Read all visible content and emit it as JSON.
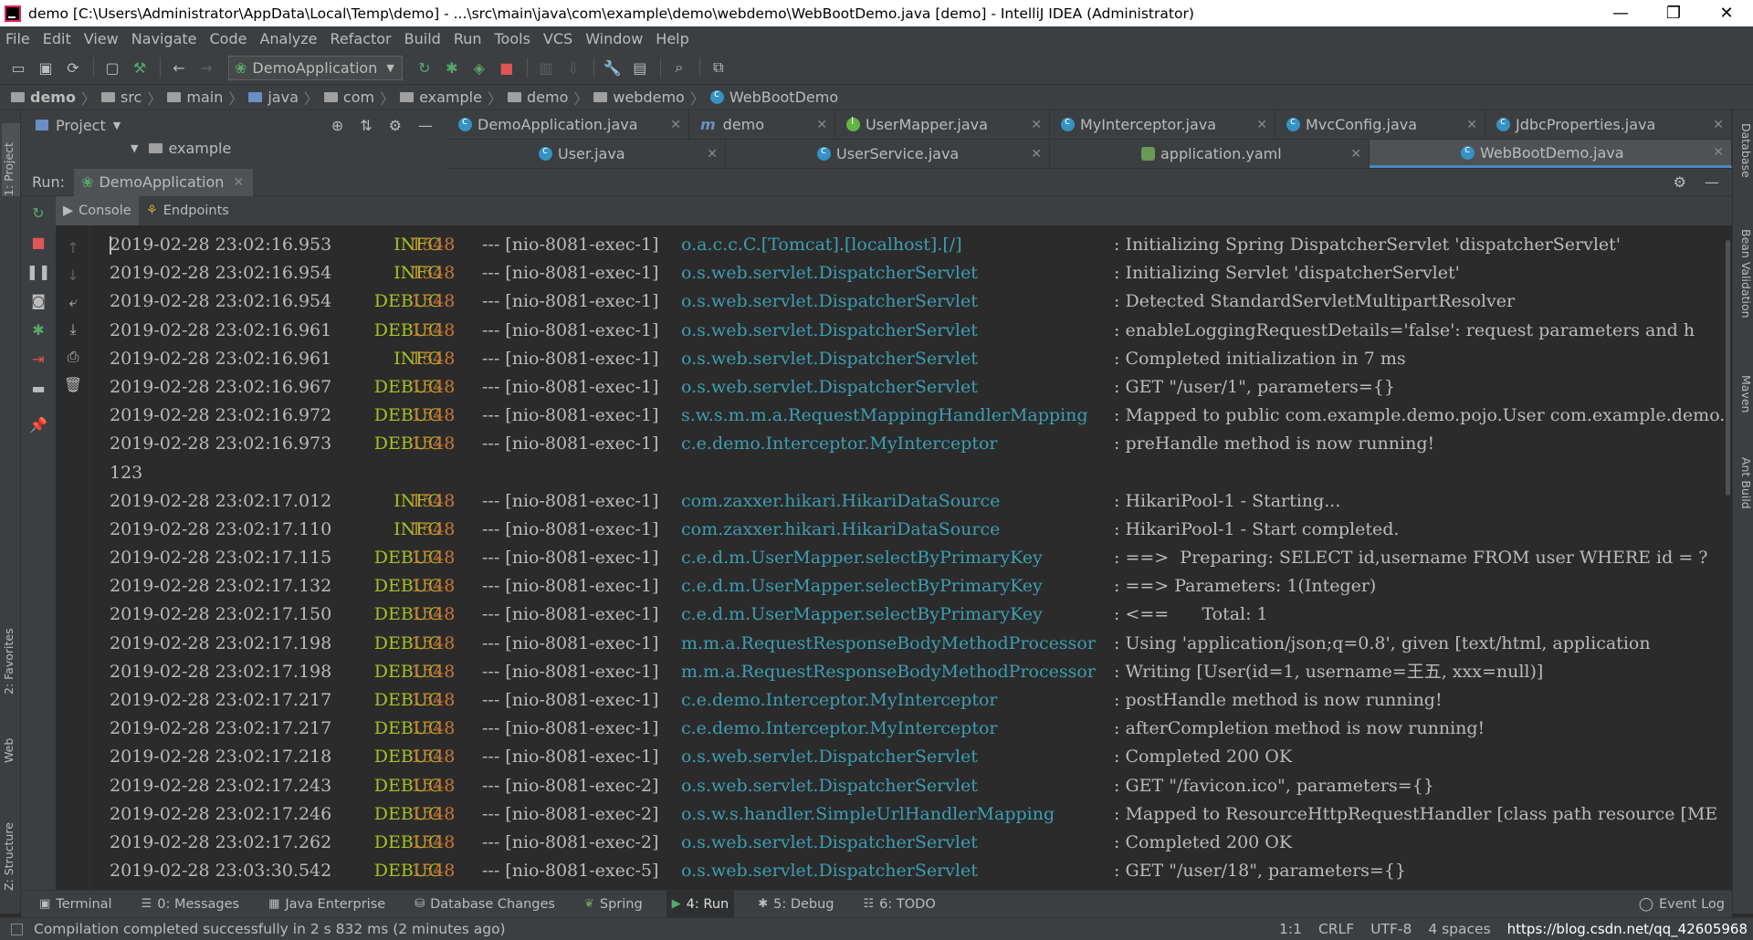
{
  "titlebar": {
    "title": "demo [C:\\Users\\Administrator\\AppData\\Local\\Temp\\demo] - ...\\src\\main\\java\\com\\example\\demo\\webdemo\\WebBootDemo.java [demo] - IntelliJ IDEA (Administrator)",
    "minimize": "—",
    "maximize": "❐",
    "close": "✕"
  },
  "menu": [
    "File",
    "Edit",
    "View",
    "Navigate",
    "Code",
    "Analyze",
    "Refactor",
    "Build",
    "Run",
    "Tools",
    "VCS",
    "Window",
    "Help"
  ],
  "toolbar": {
    "run_config": "DemoApplication"
  },
  "breadcrumb": [
    "demo",
    "src",
    "main",
    "java",
    "com",
    "example",
    "demo",
    "webdemo",
    "WebBootDemo"
  ],
  "project_panel": {
    "title": "Project",
    "tree_item": "example"
  },
  "tabs_row1": [
    {
      "label": "DemoApplication.java",
      "icon": "class-icon"
    },
    {
      "label": "demo",
      "icon": "module-icon"
    },
    {
      "label": "UserMapper.java",
      "icon": "interface-icon"
    },
    {
      "label": "MyInterceptor.java",
      "icon": "class-icon"
    },
    {
      "label": "MvcConfig.java",
      "icon": "class-icon"
    },
    {
      "label": "JdbcProperties.java",
      "icon": "class-icon"
    }
  ],
  "tabs_row2": [
    {
      "label": "User.java",
      "icon": "class-icon"
    },
    {
      "label": "UserService.java",
      "icon": "class-icon"
    },
    {
      "label": "application.yaml",
      "icon": "yaml-icon"
    },
    {
      "label": "WebBootDemo.java",
      "icon": "class-icon",
      "active": true
    }
  ],
  "run_panel": {
    "label": "Run:",
    "tab": "DemoApplication",
    "console_tab": "Console",
    "endpoints_tab": "Endpoints"
  },
  "console": {
    "lines": [
      {
        "ts": "2019-02-28 23:02:16.953",
        "level": "INFO",
        "pid": "1548",
        "thread": "--- [nio-8081-exec-1]",
        "logger": "o.a.c.c.C.[Tomcat].[localhost].[/]",
        "msg": ": Initializing Spring DispatcherServlet 'dispatcherServlet'"
      },
      {
        "ts": "2019-02-28 23:02:16.954",
        "level": "INFO",
        "pid": "1548",
        "thread": "--- [nio-8081-exec-1]",
        "logger": "o.s.web.servlet.DispatcherServlet",
        "msg": ": Initializing Servlet 'dispatcherServlet'"
      },
      {
        "ts": "2019-02-28 23:02:16.954",
        "level": "DEBUG",
        "pid": "1548",
        "thread": "--- [nio-8081-exec-1]",
        "logger": "o.s.web.servlet.DispatcherServlet",
        "msg": ": Detected StandardServletMultipartResolver"
      },
      {
        "ts": "2019-02-28 23:02:16.961",
        "level": "DEBUG",
        "pid": "1548",
        "thread": "--- [nio-8081-exec-1]",
        "logger": "o.s.web.servlet.DispatcherServlet",
        "msg": ": enableLoggingRequestDetails='false': request parameters and h"
      },
      {
        "ts": "2019-02-28 23:02:16.961",
        "level": "INFO",
        "pid": "1548",
        "thread": "--- [nio-8081-exec-1]",
        "logger": "o.s.web.servlet.DispatcherServlet",
        "msg": ": Completed initialization in 7 ms"
      },
      {
        "ts": "2019-02-28 23:02:16.967",
        "level": "DEBUG",
        "pid": "1548",
        "thread": "--- [nio-8081-exec-1]",
        "logger": "o.s.web.servlet.DispatcherServlet",
        "msg": ": GET \"/user/1\", parameters={}"
      },
      {
        "ts": "2019-02-28 23:02:16.972",
        "level": "DEBUG",
        "pid": "1548",
        "thread": "--- [nio-8081-exec-1]",
        "logger": "s.w.s.m.m.a.RequestMappingHandlerMapping",
        "msg": ": Mapped to public com.example.demo.pojo.User com.example.demo."
      },
      {
        "ts": "2019-02-28 23:02:16.973",
        "level": "DEBUG",
        "pid": "1548",
        "thread": "--- [nio-8081-exec-1]",
        "logger": "c.e.demo.Interceptor.MyInterceptor",
        "msg": ": preHandle method is now running!"
      },
      {
        "plain": "123"
      },
      {
        "ts": "2019-02-28 23:02:17.012",
        "level": "INFO",
        "pid": "1548",
        "thread": "--- [nio-8081-exec-1]",
        "logger": "com.zaxxer.hikari.HikariDataSource",
        "msg": ": HikariPool-1 - Starting..."
      },
      {
        "ts": "2019-02-28 23:02:17.110",
        "level": "INFO",
        "pid": "1548",
        "thread": "--- [nio-8081-exec-1]",
        "logger": "com.zaxxer.hikari.HikariDataSource",
        "msg": ": HikariPool-1 - Start completed."
      },
      {
        "ts": "2019-02-28 23:02:17.115",
        "level": "DEBUG",
        "pid": "1548",
        "thread": "--- [nio-8081-exec-1]",
        "logger": "c.e.d.m.UserMapper.selectByPrimaryKey",
        "msg": ": ==>  Preparing: SELECT id,username FROM user WHERE id = ?"
      },
      {
        "ts": "2019-02-28 23:02:17.132",
        "level": "DEBUG",
        "pid": "1548",
        "thread": "--- [nio-8081-exec-1]",
        "logger": "c.e.d.m.UserMapper.selectByPrimaryKey",
        "msg": ": ==> Parameters: 1(Integer)"
      },
      {
        "ts": "2019-02-28 23:02:17.150",
        "level": "DEBUG",
        "pid": "1548",
        "thread": "--- [nio-8081-exec-1]",
        "logger": "c.e.d.m.UserMapper.selectByPrimaryKey",
        "msg": ": <==      Total: 1"
      },
      {
        "ts": "2019-02-28 23:02:17.198",
        "level": "DEBUG",
        "pid": "1548",
        "thread": "--- [nio-8081-exec-1]",
        "logger": "m.m.a.RequestResponseBodyMethodProcessor",
        "msg": ": Using 'application/json;q=0.8', given [text/html, application"
      },
      {
        "ts": "2019-02-28 23:02:17.198",
        "level": "DEBUG",
        "pid": "1548",
        "thread": "--- [nio-8081-exec-1]",
        "logger": "m.m.a.RequestResponseBodyMethodProcessor",
        "msg": ": Writing [User(id=1, username=王五, xxx=null)]"
      },
      {
        "ts": "2019-02-28 23:02:17.217",
        "level": "DEBUG",
        "pid": "1548",
        "thread": "--- [nio-8081-exec-1]",
        "logger": "c.e.demo.Interceptor.MyInterceptor",
        "msg": ": postHandle method is now running!"
      },
      {
        "ts": "2019-02-28 23:02:17.217",
        "level": "DEBUG",
        "pid": "1548",
        "thread": "--- [nio-8081-exec-1]",
        "logger": "c.e.demo.Interceptor.MyInterceptor",
        "msg": ": afterCompletion method is now running!"
      },
      {
        "ts": "2019-02-28 23:02:17.218",
        "level": "DEBUG",
        "pid": "1548",
        "thread": "--- [nio-8081-exec-1]",
        "logger": "o.s.web.servlet.DispatcherServlet",
        "msg": ": Completed 200 OK"
      },
      {
        "ts": "2019-02-28 23:02:17.243",
        "level": "DEBUG",
        "pid": "1548",
        "thread": "--- [nio-8081-exec-2]",
        "logger": "o.s.web.servlet.DispatcherServlet",
        "msg": ": GET \"/favicon.ico\", parameters={}"
      },
      {
        "ts": "2019-02-28 23:02:17.246",
        "level": "DEBUG",
        "pid": "1548",
        "thread": "--- [nio-8081-exec-2]",
        "logger": "o.s.w.s.handler.SimpleUrlHandlerMapping",
        "msg": ": Mapped to ResourceHttpRequestHandler [class path resource [ME"
      },
      {
        "ts": "2019-02-28 23:02:17.262",
        "level": "DEBUG",
        "pid": "1548",
        "thread": "--- [nio-8081-exec-2]",
        "logger": "o.s.web.servlet.DispatcherServlet",
        "msg": ": Completed 200 OK"
      },
      {
        "ts": "2019-02-28 23:03:30.542",
        "level": "DEBUG",
        "pid": "1548",
        "thread": "--- [nio-8081-exec-5]",
        "logger": "o.s.web.servlet.DispatcherServlet",
        "msg": ": GET \"/user/18\", parameters={}"
      }
    ]
  },
  "left_strip": {
    "project": "1: Project",
    "favorites": "2: Favorites",
    "web": "Web",
    "structure": "Z: Structure"
  },
  "right_strip": {
    "database": "Database",
    "bean_validation": "Bean Validation",
    "maven": "Maven",
    "ant_build": "Ant Build"
  },
  "bottom_tabs": [
    {
      "label": "Terminal",
      "icon": "terminal-icon"
    },
    {
      "label": "0: Messages",
      "icon": "messages-icon"
    },
    {
      "label": "Java Enterprise",
      "icon": "java-enterprise-icon"
    },
    {
      "label": "Database Changes",
      "icon": "database-changes-icon"
    },
    {
      "label": "Spring",
      "icon": "spring-icon"
    },
    {
      "label": "4: Run",
      "icon": "run-icon",
      "active": true
    },
    {
      "label": "5: Debug",
      "icon": "debug-icon"
    },
    {
      "label": "6: TODO",
      "icon": "todo-icon"
    }
  ],
  "event_log": "Event Log",
  "status": {
    "message": "Compilation completed successfully in 2 s 832 ms (2 minutes ago)",
    "position": "1:1",
    "line_sep": "CRLF",
    "encoding": "UTF-8",
    "indent": "4 spaces",
    "watermark": "https://blog.csdn.net/qq_42605968"
  }
}
